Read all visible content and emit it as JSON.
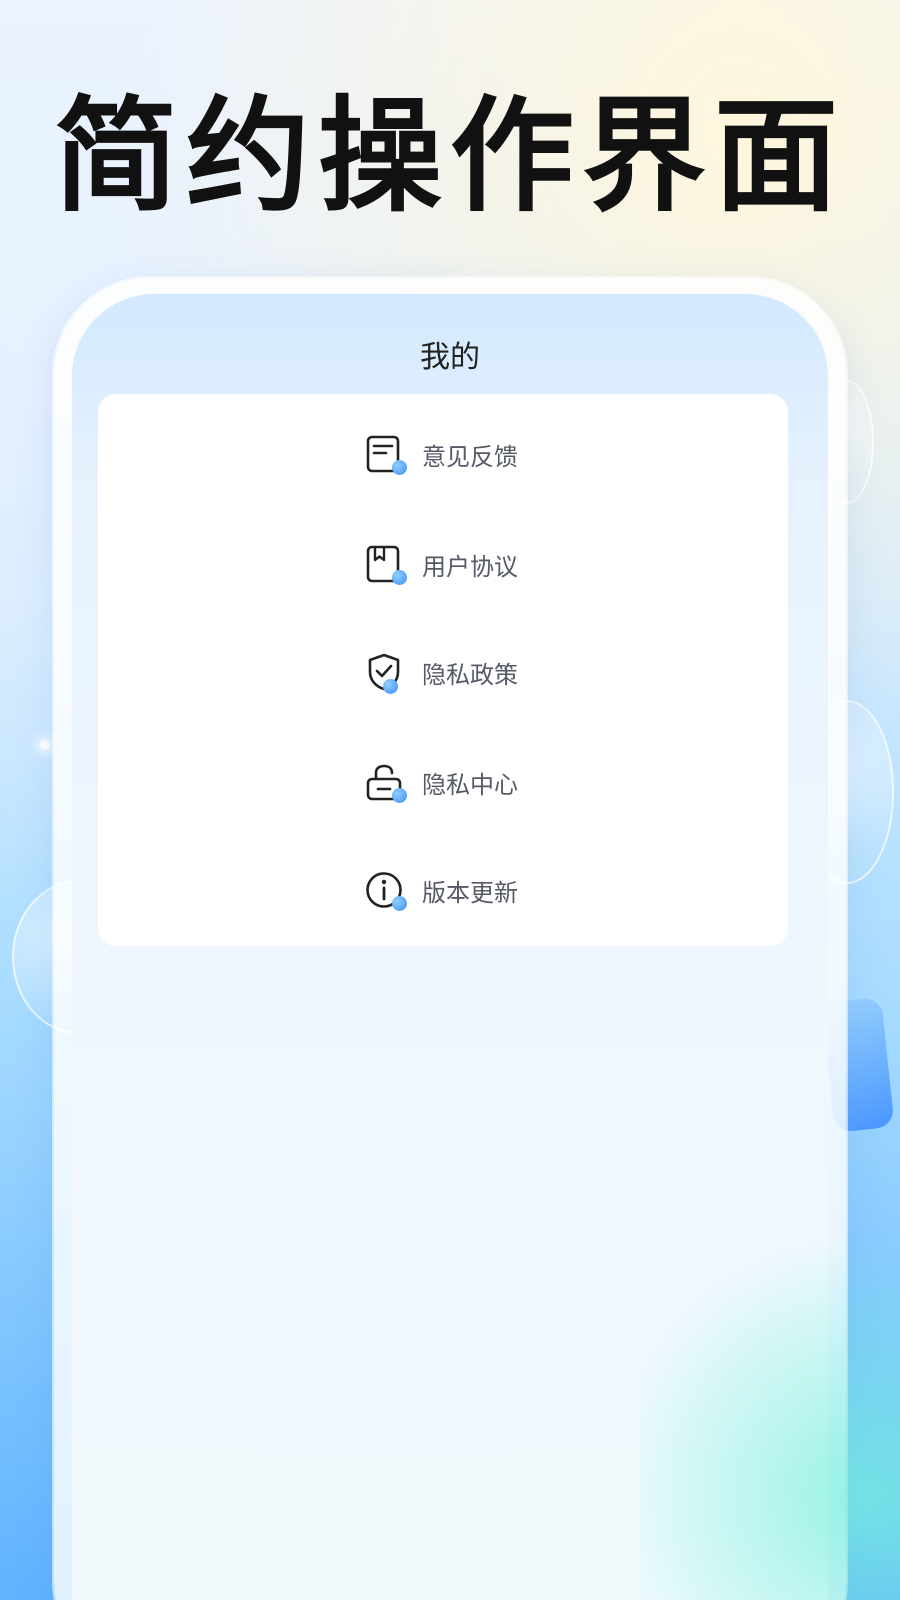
{
  "headline": "简约操作界面",
  "screen": {
    "title": "我的"
  },
  "menu": {
    "items": [
      {
        "label": "意见反馈",
        "icon": "feedback-icon"
      },
      {
        "label": "用户协议",
        "icon": "agreement-icon"
      },
      {
        "label": "隐私政策",
        "icon": "privacy-shield-icon"
      },
      {
        "label": "隐私中心",
        "icon": "privacy-lock-icon"
      },
      {
        "label": "版本更新",
        "icon": "info-icon"
      }
    ]
  },
  "colors": {
    "accent": "#3d8cf5",
    "headline": "#111111",
    "menu_text": "#555a66"
  }
}
